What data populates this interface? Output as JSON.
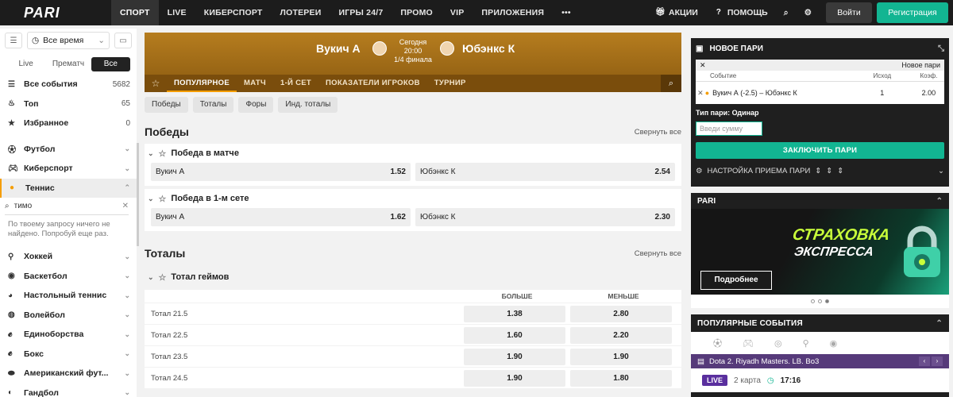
{
  "logo": "PARI",
  "nav": [
    "СПОРТ",
    "LIVE",
    "КИБЕРСПОРТ",
    "ЛОТЕРЕИ",
    "ИГРЫ 24/7",
    "ПРОМО",
    "VIP",
    "ПРИЛОЖЕНИЯ"
  ],
  "top_right": {
    "promo": "АКЦИИ",
    "help": "ПОМОЩЬ",
    "login": "Войти",
    "register": "Регистрация"
  },
  "sidebar": {
    "time_filter": "Все время",
    "tabs": [
      "Live",
      "Прематч",
      "Все"
    ],
    "top_items": [
      {
        "label": "Все события",
        "count": "5682"
      },
      {
        "label": "Топ",
        "count": "65"
      },
      {
        "label": "Избранное",
        "count": "0"
      }
    ],
    "sports": [
      "Футбол",
      "Киберспорт",
      "Теннис"
    ],
    "search_value": "тимо",
    "no_results": "По твоему запросу ничего не найдено. Попробуй еще раз.",
    "sports2": [
      "Хоккей",
      "Баскетбол",
      "Настольный теннис",
      "Волейбол",
      "Единоборства",
      "Бокс",
      "Американский фут...",
      "Гандбол"
    ]
  },
  "event": {
    "team_a": "Вукич А",
    "team_b": "Юбэнкс К",
    "day": "Сегодня",
    "time": "20:00",
    "stage": "1/4 финала",
    "tabs": [
      "ПОПУЛЯРНОЕ",
      "МАТЧ",
      "1-Й СЕТ",
      "ПОКАЗАТЕЛИ ИГРОКОВ",
      "ТУРНИР"
    ],
    "chips": [
      "Победы",
      "Тоталы",
      "Форы",
      "Инд. тоталы"
    ]
  },
  "wins": {
    "title": "Победы",
    "collapse": "Свернуть все",
    "markets": [
      {
        "name": "Победа в матче",
        "a": "Вукич А",
        "a_odd": "1.52",
        "b": "Юбэнкс К",
        "b_odd": "2.54"
      },
      {
        "name": "Победа в 1-м сете",
        "a": "Вукич А",
        "a_odd": "1.62",
        "b": "Юбэнкс К",
        "b_odd": "2.30"
      }
    ]
  },
  "totals": {
    "title": "Тоталы",
    "collapse": "Свернуть все",
    "market": "Тотал геймов",
    "over": "БОЛЬШЕ",
    "under": "МЕНЬШЕ",
    "rows": [
      {
        "name": "Тотал 21.5",
        "over": "1.38",
        "under": "2.80"
      },
      {
        "name": "Тотал 22.5",
        "over": "1.60",
        "under": "2.20"
      },
      {
        "name": "Тотал 23.5",
        "over": "1.90",
        "under": "1.90"
      },
      {
        "name": "Тотал 24.5",
        "over": "1.90",
        "under": "1.80"
      }
    ]
  },
  "slip": {
    "title": "НОВОЕ ПАРИ",
    "new_bet": "Новое пари",
    "col_event": "Событие",
    "col_outcome": "Исход",
    "col_odd": "Коэф.",
    "event": "Вукич А (-2.5) – Юбэнкс К",
    "outcome": "1",
    "odd": "2.00",
    "type": "Тип пари: Одинар",
    "placeholder": "Введи сумму",
    "button": "ЗАКЛЮЧИТЬ ПАРИ",
    "settings": "НАСТРОЙКА ПРИЕМА ПАРИ"
  },
  "promo": {
    "title": "PARI",
    "line1": "СТРАХОВКА",
    "line2": "ЭКСПРЕССА",
    "button": "Подробнее"
  },
  "popular": {
    "title": "ПОПУЛЯРНЫЕ СОБЫТИЯ",
    "match": "Dota 2. Riyadh Masters. LB. Bo3",
    "live": "LIVE",
    "map": "2 карта",
    "time": "17:16"
  },
  "colors": {
    "accent": "#12b592",
    "orange": "#f59d00",
    "hero": "#a46f18",
    "live": "#5a2f9e"
  }
}
